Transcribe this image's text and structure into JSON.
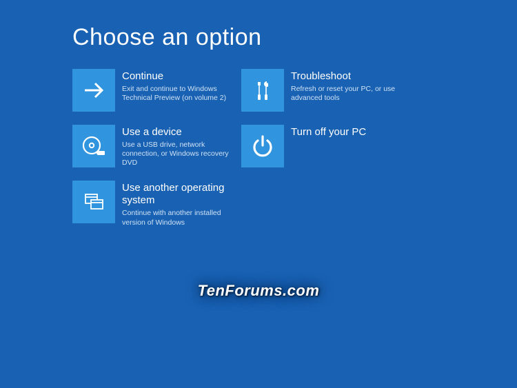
{
  "title": "Choose an option",
  "options": {
    "continue": {
      "title": "Continue",
      "desc": "Exit and continue to Windows Technical Preview (on volume 2)"
    },
    "troubleshoot": {
      "title": "Troubleshoot",
      "desc": "Refresh or reset your PC, or use advanced tools"
    },
    "use_device": {
      "title": "Use a device",
      "desc": "Use a USB drive, network connection, or Windows recovery DVD"
    },
    "turn_off": {
      "title": "Turn off your PC",
      "desc": ""
    },
    "use_os": {
      "title": "Use another operating system",
      "desc": "Continue with another installed version of Windows"
    }
  },
  "watermark": "TenForums.com"
}
